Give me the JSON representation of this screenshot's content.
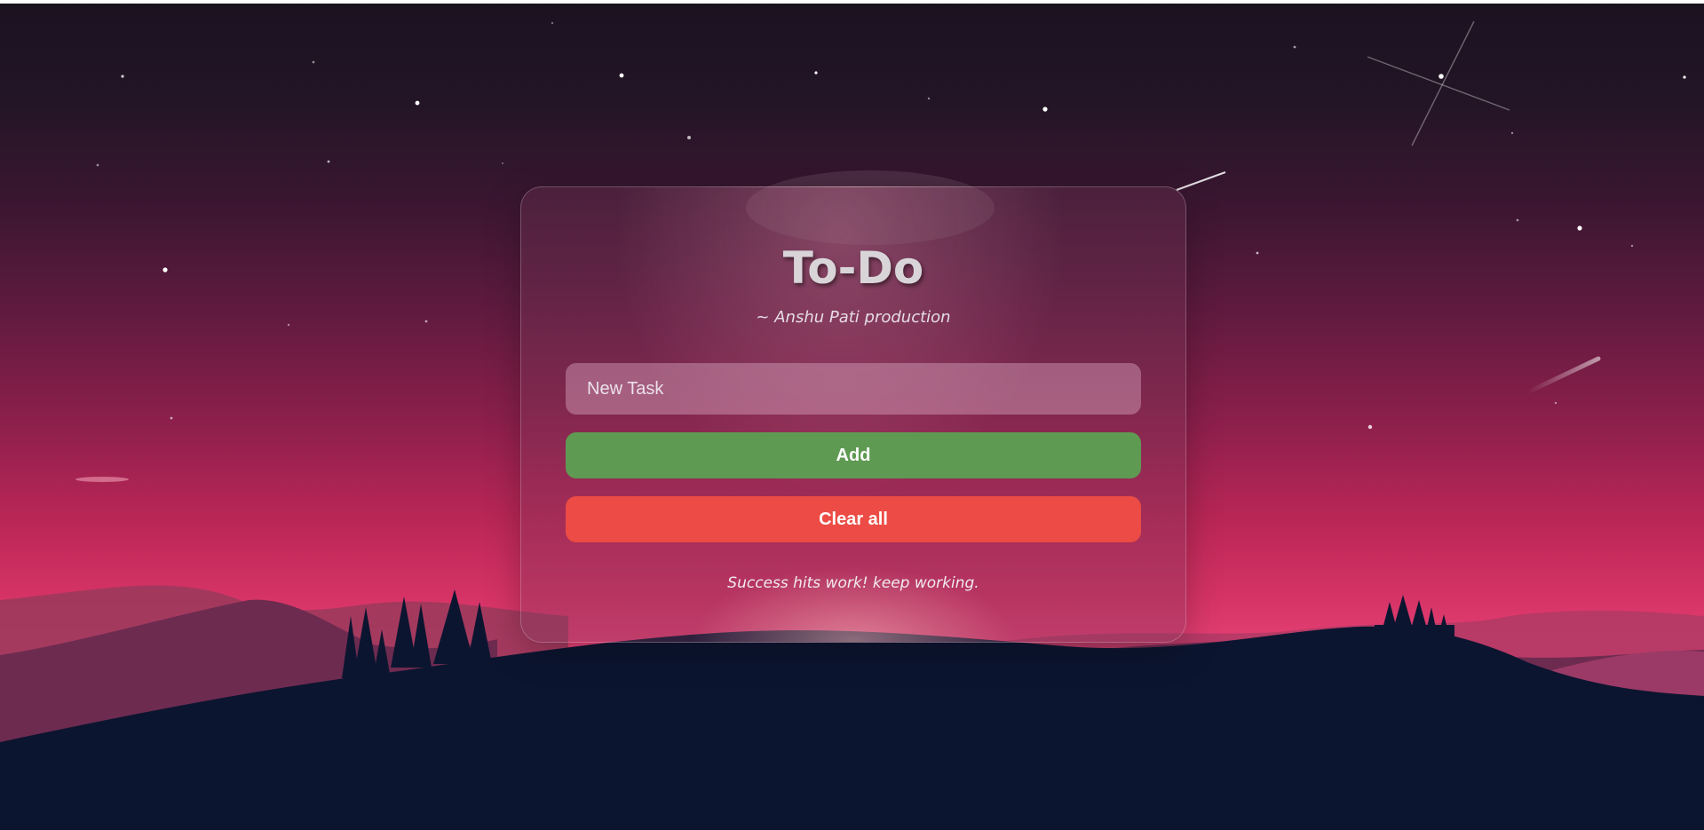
{
  "app": {
    "title": "To-Do",
    "subtitle": "~ Anshu Pati production",
    "quote": "Success hits work! keep working."
  },
  "form": {
    "task_placeholder": "New Task",
    "task_value": ""
  },
  "buttons": {
    "add_label": "Add",
    "clear_label": "Clear all"
  },
  "colors": {
    "add_button": "#5f9a53",
    "clear_button": "#ec4c45",
    "title_text": "#d8d4d8"
  }
}
